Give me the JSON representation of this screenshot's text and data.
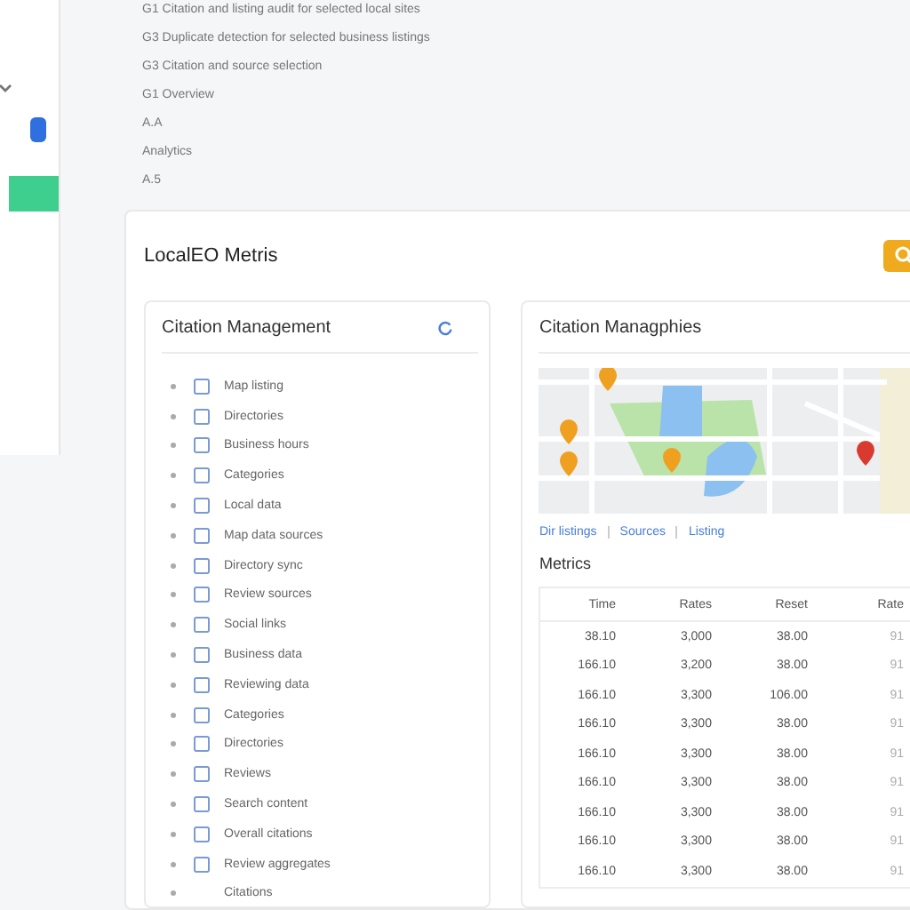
{
  "sidebar": {
    "items": [
      {
        "kind": "chevron"
      },
      {
        "kind": "marker",
        "color": "#2f6fe0"
      },
      {
        "kind": "bar",
        "color": "#3ecf8e"
      }
    ]
  },
  "outline": [
    "G1 Citation and listing audit for selected local sites",
    "G3 Duplicate detection for selected business listings",
    "G3 Citation and source selection",
    "G1 Overview",
    "A.A",
    "Analytics",
    "A.5"
  ],
  "dashboard": {
    "title": "LocalEO Metris",
    "citations": {
      "title": "Citation Management",
      "items": [
        {
          "label": "Map listing",
          "checked": false
        },
        {
          "label": "Directories",
          "checked": false
        },
        {
          "label": "Business hours",
          "checked": false
        },
        {
          "label": "Categories",
          "checked": false
        },
        {
          "label": "Local data",
          "checked": false
        },
        {
          "label": "Map data sources",
          "checked": false
        },
        {
          "label": "Directory sync",
          "checked": false
        },
        {
          "label": "Review sources",
          "checked": false
        },
        {
          "label": "Social links",
          "checked": false
        },
        {
          "label": "Business data",
          "checked": false
        },
        {
          "label": "Reviewing data",
          "checked": false
        },
        {
          "label": "Categories",
          "checked": false
        },
        {
          "label": "Directories",
          "checked": false
        },
        {
          "label": "Reviews",
          "checked": false
        },
        {
          "label": "Search content",
          "checked": false
        },
        {
          "label": "Overall citations",
          "checked": false
        },
        {
          "label": "Review aggregates",
          "checked": false
        }
      ],
      "footer": "Citations"
    },
    "map_panel": {
      "title": "Citation Managphies",
      "links": [
        "Dir listings",
        "Sources",
        "Listing"
      ],
      "metrics": {
        "title": "Metrics",
        "columns": [
          "Time",
          "Rates",
          "Reset",
          "Rate"
        ],
        "rows": [
          [
            "38.10",
            "3,000",
            "38.00",
            "91"
          ],
          [
            "166.10",
            "3,200",
            "38.00",
            "91"
          ],
          [
            "166.10",
            "3,300",
            "106.00",
            "91"
          ],
          [
            "166.10",
            "3,300",
            "38.00",
            "91"
          ],
          [
            "166.10",
            "3,300",
            "38.00",
            "91"
          ],
          [
            "166.10",
            "3,300",
            "38.00",
            "91"
          ],
          [
            "166.10",
            "3,300",
            "38.00",
            "91"
          ],
          [
            "166.10",
            "3,300",
            "38.00",
            "91"
          ],
          [
            "166.10",
            "3,300",
            "38.00",
            "91"
          ]
        ]
      }
    }
  }
}
